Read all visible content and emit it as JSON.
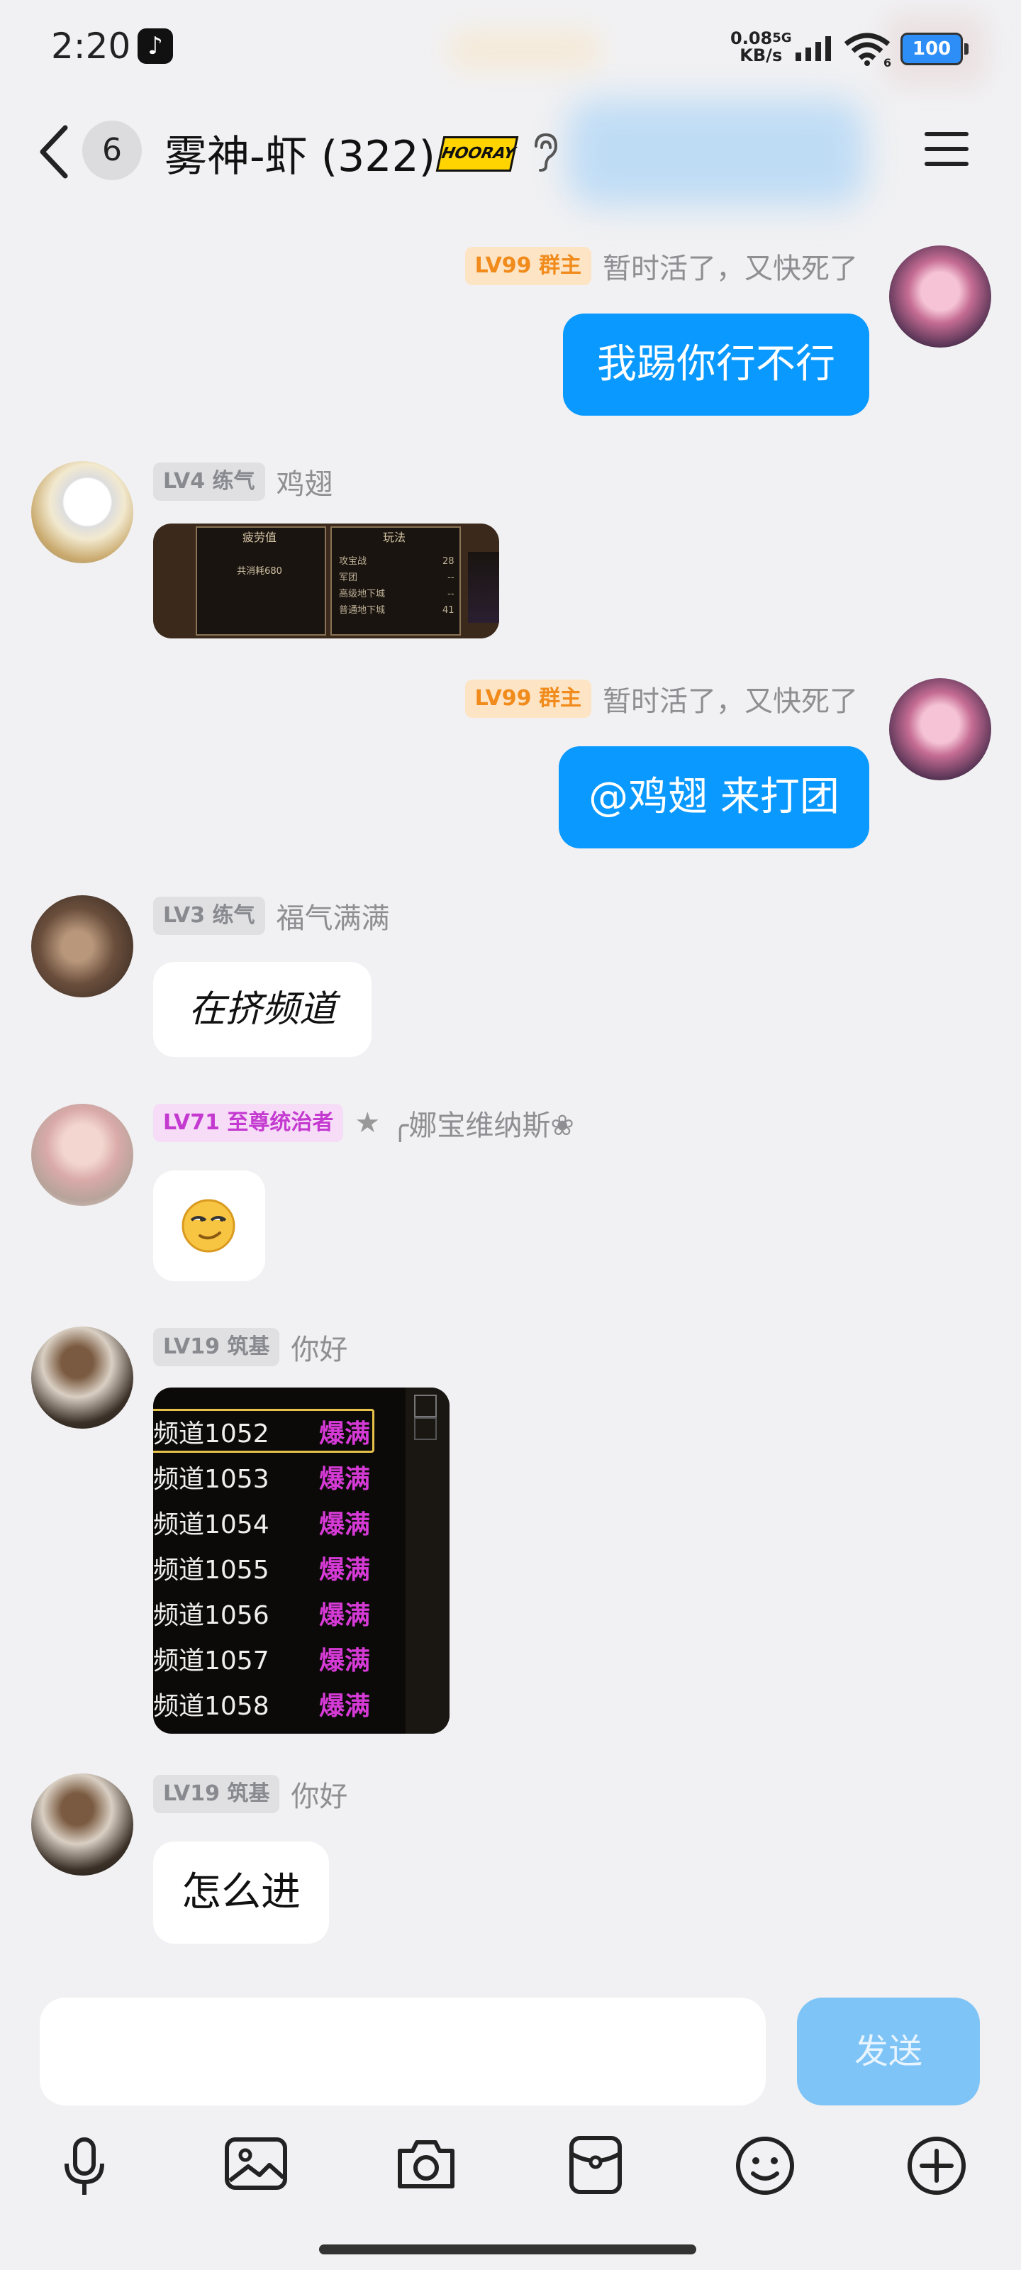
{
  "status_bar": {
    "time": "2:20",
    "network_speed": "0.08",
    "network_unit": "KB/s",
    "network_type": "5G",
    "wifi_band": "6",
    "battery": "100",
    "app_icon": "tiktok-icon"
  },
  "header": {
    "unread_count": "6",
    "title": "雾神-虾 (322)",
    "badge_text": "HOORAY",
    "icons": [
      "back-arrow-icon",
      "hooray-badge",
      "ear-icon",
      "menu-icon"
    ]
  },
  "messages": [
    {
      "side": "right",
      "level": "LV99",
      "title": "群主",
      "nickname": "暂时活了，又快死了",
      "type": "text",
      "text": "我踢你行不行"
    },
    {
      "side": "left",
      "level": "LV4",
      "title": "练气",
      "nickname": "鸡翅",
      "type": "image",
      "image": {
        "headers": [
          "疲劳值",
          "玩法"
        ],
        "left_line": "共消耗680",
        "rows": [
          {
            "label": "攻宝战",
            "value": "28"
          },
          {
            "label": "军团",
            "value": "--"
          },
          {
            "label": "高级地下城",
            "value": "--"
          },
          {
            "label": "普通地下城",
            "value": "41"
          }
        ]
      }
    },
    {
      "side": "right",
      "level": "LV99",
      "title": "群主",
      "nickname": "暂时活了，又快死了",
      "type": "text",
      "text": "@鸡翅 来打团"
    },
    {
      "side": "left",
      "level": "LV3",
      "title": "练气",
      "nickname": "福气满满",
      "type": "text",
      "text": "在挤频道"
    },
    {
      "side": "left",
      "level": "LV71",
      "title": "至尊统治者",
      "star": "★",
      "nickname": "╭娜宝维纳斯❀",
      "type": "emoji",
      "text": "😏"
    },
    {
      "side": "left",
      "level": "LV19",
      "title": "筑基",
      "nickname": "你好",
      "type": "image",
      "image": {
        "rows": [
          {
            "channel": "频道1052",
            "status": "爆满"
          },
          {
            "channel": "频道1053",
            "status": "爆满"
          },
          {
            "channel": "频道1054",
            "status": "爆满"
          },
          {
            "channel": "频道1055",
            "status": "爆满"
          },
          {
            "channel": "频道1056",
            "status": "爆满"
          },
          {
            "channel": "频道1057",
            "status": "爆满"
          },
          {
            "channel": "频道1058",
            "status": "爆满"
          }
        ]
      }
    },
    {
      "side": "left",
      "level": "LV19",
      "title": "筑基",
      "nickname": "你好",
      "type": "text",
      "text": "怎么进"
    }
  ],
  "input": {
    "placeholder": "",
    "send_label": "发送"
  },
  "toolbar": [
    "microphone-icon",
    "image-icon",
    "camera-icon",
    "red-packet-icon",
    "emoji-icon",
    "plus-icon"
  ],
  "colors": {
    "bubble_blue": "#0a99ff",
    "owner_tag": "#f08b1c",
    "send_disabled": "#7ec4f6"
  }
}
